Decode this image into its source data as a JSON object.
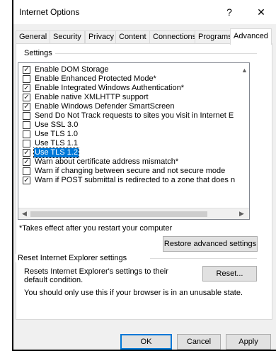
{
  "window": {
    "title": "Internet Options",
    "help_glyph": "?",
    "close_glyph": "✕"
  },
  "tabs": [
    {
      "label": "General"
    },
    {
      "label": "Security"
    },
    {
      "label": "Privacy"
    },
    {
      "label": "Content"
    },
    {
      "label": "Connections"
    },
    {
      "label": "Programs"
    },
    {
      "label": "Advanced",
      "active": true
    }
  ],
  "settings": {
    "group_label": "Settings",
    "items": [
      {
        "label": "Enable DOM Storage",
        "checked": true
      },
      {
        "label": "Enable Enhanced Protected Mode*",
        "checked": false
      },
      {
        "label": "Enable Integrated Windows Authentication*",
        "checked": true
      },
      {
        "label": "Enable native XMLHTTP support",
        "checked": true
      },
      {
        "label": "Enable Windows Defender SmartScreen",
        "checked": true
      },
      {
        "label": "Send Do Not Track requests to sites you visit in Internet E",
        "checked": false
      },
      {
        "label": "Use SSL 3.0",
        "checked": false
      },
      {
        "label": "Use TLS 1.0",
        "checked": false
      },
      {
        "label": "Use TLS 1.1",
        "checked": false
      },
      {
        "label": "Use TLS 1.2",
        "checked": true,
        "selected": true
      },
      {
        "label": "Warn about certificate address mismatch*",
        "checked": true
      },
      {
        "label": "Warn if changing between secure and not secure mode",
        "checked": false
      },
      {
        "label": "Warn if POST submittal is redirected to a zone that does n",
        "checked": true
      }
    ],
    "note": "*Takes effect after you restart your computer",
    "restore_label": "Restore advanced settings"
  },
  "reset": {
    "group_label": "Reset Internet Explorer settings",
    "description": "Resets Internet Explorer's settings to their default condition.",
    "button_label": "Reset...",
    "warning": "You should only use this if your browser is in an unusable state."
  },
  "footer": {
    "ok_label": "OK",
    "cancel_label": "Cancel",
    "apply_label": "Apply"
  },
  "colors": {
    "selection": "#0078d7",
    "dialog_bg": "#f0f0f0"
  }
}
